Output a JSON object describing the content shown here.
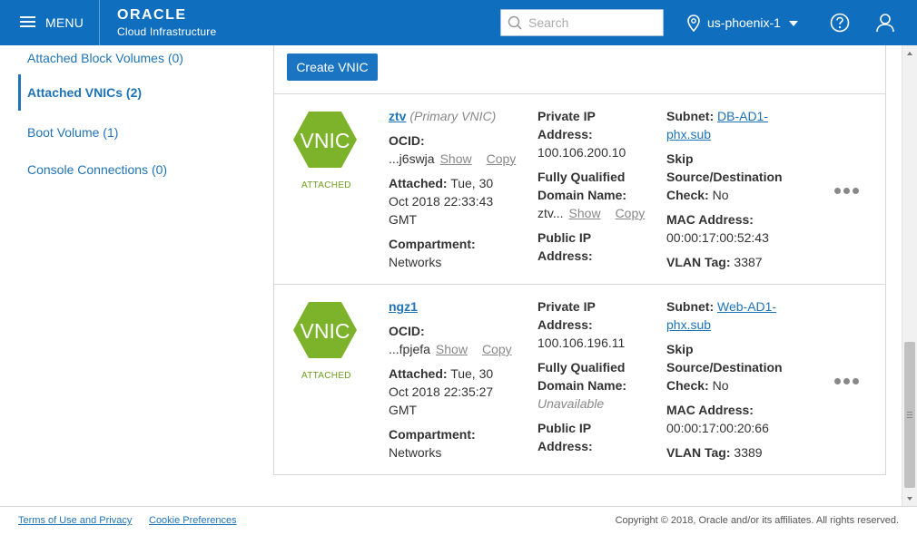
{
  "header": {
    "menu_label": "MENU",
    "brand": "ORACLE",
    "brand_sub": "Cloud Infrastructure",
    "search_placeholder": "Search",
    "region": "us-phoenix-1",
    "accent_color": "#0f6fbe"
  },
  "sidebar": {
    "items": [
      {
        "label": "Attached Block Volumes (0)",
        "active": false
      },
      {
        "label": "Attached VNICs (2)",
        "active": true
      },
      {
        "label": "Boot Volume (1)",
        "active": false
      },
      {
        "label": "Console Connections (0)",
        "active": false
      }
    ]
  },
  "main": {
    "create_button": "Create VNIC",
    "vnics": [
      {
        "icon_text": "VNIC",
        "status": "ATTACHED",
        "name": "ztv",
        "primary_note": "(Primary VNIC)",
        "ocid_label": "OCID:",
        "ocid_value": "...j6swja",
        "show": "Show",
        "copy": "Copy",
        "attached_label": "Attached:",
        "attached_l1": "Tue, 30",
        "attached_l2": "Oct 2018 22:33:43",
        "attached_l3": "GMT",
        "compartment_label": "Compartment:",
        "compartment_value": "Networks",
        "private_ip_label_1": "Private IP",
        "private_ip_label_2": "Address:",
        "private_ip_value": "100.106.200.10",
        "fqdn_label_1": "Fully Qualified",
        "fqdn_label_2": "Domain Name:",
        "fqdn_value": "ztv...",
        "fqdn_show": "Show",
        "fqdn_copy": "Copy",
        "public_ip_label_1": "Public IP",
        "public_ip_label_2": "Address:",
        "subnet_label": "Subnet:",
        "subnet_l1": "DB-AD1-",
        "subnet_l2": "phx.sub",
        "skip_label_1": "Skip",
        "skip_label_2": "Source/Destination",
        "skip_label_3": "Check:",
        "skip_value": "No",
        "mac_label": "MAC Address:",
        "mac_value": "00:00:17:00:52:43",
        "vlan_label": "VLAN Tag:",
        "vlan_value": "3387"
      },
      {
        "icon_text": "VNIC",
        "status": "ATTACHED",
        "name": "ngz1",
        "primary_note": "",
        "ocid_label": "OCID:",
        "ocid_value": "...fpjefa",
        "show": "Show",
        "copy": "Copy",
        "attached_label": "Attached:",
        "attached_l1": "Tue, 30",
        "attached_l2": "Oct 2018 22:35:27",
        "attached_l3": "GMT",
        "compartment_label": "Compartment:",
        "compartment_value": "Networks",
        "private_ip_label_1": "Private IP",
        "private_ip_label_2": "Address:",
        "private_ip_value": "100.106.196.11",
        "fqdn_label_1": "Fully Qualified",
        "fqdn_label_2": "Domain Name:",
        "fqdn_value": "Unavailable",
        "public_ip_label_1": "Public IP",
        "public_ip_label_2": "Address:",
        "subnet_label": "Subnet:",
        "subnet_l1": "Web-AD1-",
        "subnet_l2": "phx.sub",
        "skip_label_1": "Skip",
        "skip_label_2": "Source/Destination",
        "skip_label_3": "Check:",
        "skip_value": "No",
        "mac_label": "MAC Address:",
        "mac_value": "00:00:17:00:20:66",
        "vlan_label": "VLAN Tag:",
        "vlan_value": "3389"
      }
    ]
  },
  "footer": {
    "terms": "Terms of Use and Privacy",
    "cookies": "Cookie Preferences",
    "copyright": "Copyright © 2018, Oracle and/or its affiliates. All rights reserved."
  }
}
